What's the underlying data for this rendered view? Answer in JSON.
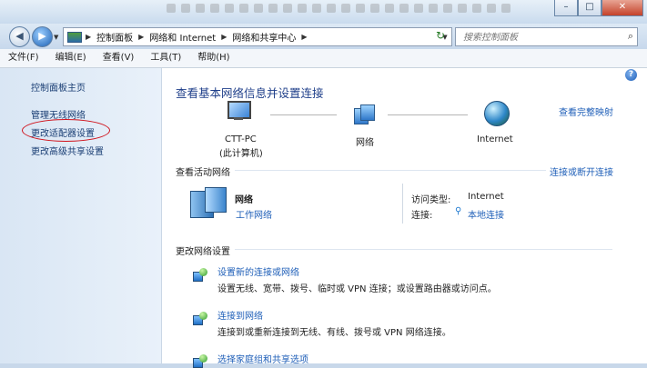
{
  "address_bar": {
    "crumbs": [
      "控制面板",
      "网络和 Internet",
      "网络和共享中心"
    ]
  },
  "search": {
    "placeholder": "搜索控制面板"
  },
  "menu": [
    "文件(F)",
    "编辑(E)",
    "查看(V)",
    "工具(T)",
    "帮助(H)"
  ],
  "sidebar": {
    "items": [
      "控制面板主页",
      "管理无线网络",
      "更改适配器设置",
      "更改高级共享设置"
    ]
  },
  "main": {
    "heading": "查看基本网络信息并设置连接",
    "view_full_map": "查看完整映射",
    "map": {
      "computer_name": "CTT-PC",
      "computer_sub": "(此计算机)",
      "network": "网络",
      "internet": "Internet"
    },
    "active_networks": {
      "title": "查看活动网络",
      "action": "连接或断开连接",
      "network_name": "网络",
      "network_type": "工作网络",
      "access_type_label": "访问类型:",
      "access_type_value": "Internet",
      "connections_label": "连接:",
      "connections_value": "本地连接"
    },
    "change_settings": {
      "title": "更改网络设置",
      "tasks": [
        {
          "title": "设置新的连接或网络",
          "desc": "设置无线、宽带、拨号、临时或 VPN 连接；或设置路由器或访问点。"
        },
        {
          "title": "连接到网络",
          "desc": "连接到或重新连接到无线、有线、拨号或 VPN 网络连接。"
        },
        {
          "title": "选择家庭组和共享选项"
        }
      ]
    }
  },
  "colors": {
    "link": "#1f5fb8",
    "heading": "#1f3f8a",
    "highlight_ellipse": "#d0121b"
  },
  "icons": [
    "back-icon",
    "forward-icon",
    "folder-icon",
    "refresh-icon",
    "search-icon",
    "help-icon",
    "computer-icon",
    "network-icon",
    "globe-icon",
    "network-bench-icon",
    "plug-icon",
    "setup-connection-icon",
    "connect-network-icon",
    "homegroup-icon"
  ]
}
